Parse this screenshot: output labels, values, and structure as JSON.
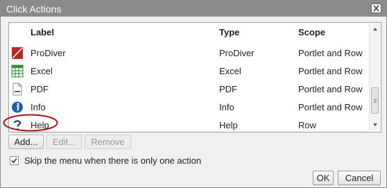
{
  "dialog": {
    "title": "Click Actions",
    "close_label": "×"
  },
  "table": {
    "columns": [
      "Label",
      "Type",
      "Scope"
    ],
    "rows": [
      {
        "label": "ProDiver",
        "type": "ProDiver",
        "scope": "Portlet and Row",
        "icon": "prodiver-icon"
      },
      {
        "label": "Excel",
        "type": "Excel",
        "scope": "Portlet and Row",
        "icon": "excel-icon"
      },
      {
        "label": "PDF",
        "type": "PDF",
        "scope": "Portlet and Row",
        "icon": "pdf-icon"
      },
      {
        "label": "Info",
        "type": "Info",
        "scope": "Portlet and Row",
        "icon": "info-icon"
      },
      {
        "label": "Help",
        "type": "Help",
        "scope": "Row",
        "icon": "help-icon"
      }
    ]
  },
  "buttons": {
    "add": "Add...",
    "edit": "Edit...",
    "remove": "Remove",
    "ok": "OK",
    "cancel": "Cancel"
  },
  "skip_menu": {
    "label": "Skip the menu when there is only one action",
    "checked": true
  },
  "colors": {
    "titlebar": "#8a8a8a",
    "highlight_circle": "#a01818",
    "prodiver_red": "#b02a2a",
    "excel_green": "#2e8b3a",
    "info_blue": "#1f5fa8",
    "help_navy": "#1a3a7a"
  }
}
